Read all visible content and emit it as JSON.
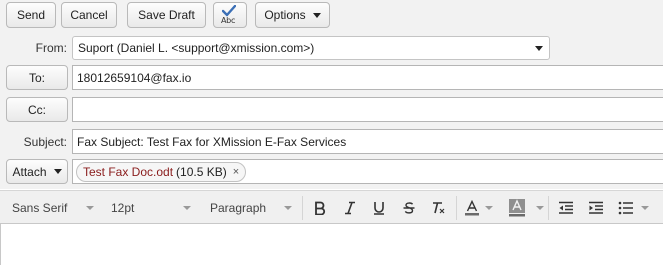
{
  "toolbar": {
    "send_label": "Send",
    "cancel_label": "Cancel",
    "save_draft_label": "Save Draft",
    "spellcheck_text": "Abc",
    "options_label": "Options"
  },
  "headers": {
    "from_label": "From:",
    "from_value": "Suport (Daniel L. <support@xmission.com>)",
    "to_button_label": "To:",
    "to_value": "18012659104@fax.io",
    "cc_button_label": "Cc:",
    "cc_value": "",
    "subject_label": "Subject:",
    "subject_value": "Fax Subject: Test Fax for XMission E-Fax Services",
    "attach_label": "Attach",
    "attachment": {
      "name": "Test Fax Doc.odt",
      "size": "(10.5 KB)",
      "remove_glyph": "×"
    }
  },
  "editor_toolbar": {
    "font_family": "Sans Serif",
    "font_size": "12pt",
    "block_format": "Paragraph",
    "icons": [
      "bold-icon",
      "italic-icon",
      "underline-icon",
      "strikethrough-icon",
      "clear-formatting-icon",
      "text-color-icon",
      "highlight-color-icon",
      "outdent-icon",
      "indent-icon",
      "bulleted-list-icon"
    ],
    "colors": {
      "text_color_bar": "#6a6a6a",
      "highlight_bg": "#8f8f8f"
    }
  },
  "colors": {
    "toolbar_bg": "#f2f2f2",
    "attachment_name": "#8a1c1c",
    "spell_check": "#3b6fb6"
  }
}
